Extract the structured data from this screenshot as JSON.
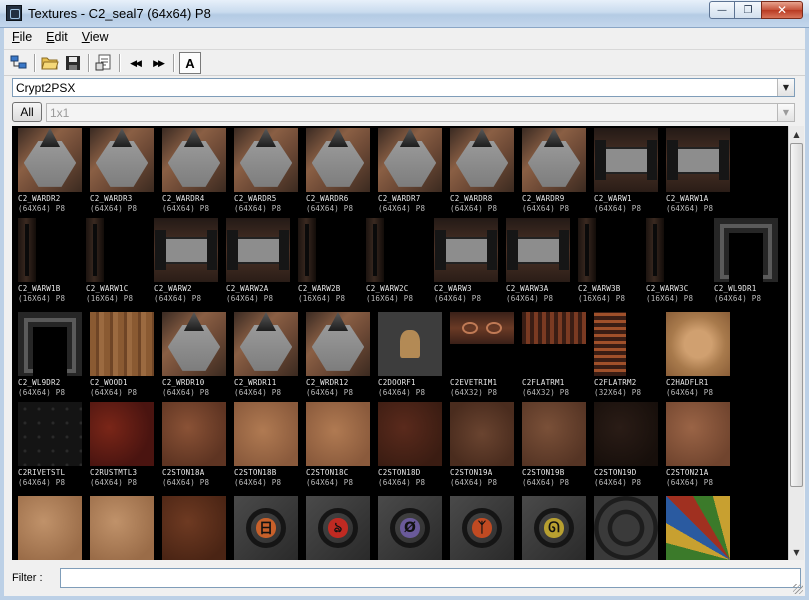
{
  "window": {
    "title": "Textures - C2_seal7 (64x64) P8",
    "min_glyph": "—",
    "max_glyph": "❐",
    "close_glyph": "✕"
  },
  "menu": [
    {
      "label": "File",
      "mnemonic": "F",
      "rest": "ile"
    },
    {
      "label": "Edit",
      "mnemonic": "E",
      "rest": "dit"
    },
    {
      "label": "View",
      "mnemonic": "V",
      "rest": "iew"
    }
  ],
  "toolbar": {
    "icons": [
      "window-tree-icon",
      "open-folder-icon",
      "save-disk-icon",
      "properties-icon",
      "previous-icon",
      "next-icon",
      "font-icon"
    ],
    "prev_glyph": "◀◀",
    "next_glyph": "▶▶",
    "font_label": "A"
  },
  "package_combo": {
    "value": "Crypt2PSX",
    "arrow": "▼"
  },
  "size_filter": {
    "all_label": "All",
    "value": "1x1",
    "arrow": "▼"
  },
  "textures": [
    [
      {
        "name": "C2_WARDR2",
        "size": "(64X64) P8",
        "style": "ward"
      },
      {
        "name": "C2_WARDR3",
        "size": "(64X64) P8",
        "style": "ward"
      },
      {
        "name": "C2_WARDR4",
        "size": "(64X64) P8",
        "style": "ward"
      },
      {
        "name": "C2_WARDR5",
        "size": "(64X64) P8",
        "style": "ward"
      },
      {
        "name": "C2_WARDR6",
        "size": "(64X64) P8",
        "style": "ward"
      },
      {
        "name": "C2_WARDR7",
        "size": "(64X64) P8",
        "style": "ward"
      },
      {
        "name": "C2_WARDR8",
        "size": "(64X64) P8",
        "style": "ward"
      },
      {
        "name": "C2_WARDR9",
        "size": "(64X64) P8",
        "style": "ward"
      },
      {
        "name": "C2_WARW1",
        "size": "(64X64) P8",
        "style": "warw"
      },
      {
        "name": "C2_WARW1A",
        "size": "(64X64) P8",
        "style": "warw"
      }
    ],
    [
      {
        "name": "C2_WARW1B",
        "size": "(16X64) P8",
        "style": "thin"
      },
      {
        "name": "C2_WARW1C",
        "size": "(16X64) P8",
        "style": "thin"
      },
      {
        "name": "C2_WARW2",
        "size": "(64X64) P8",
        "style": "warw"
      },
      {
        "name": "C2_WARW2A",
        "size": "(64X64) P8",
        "style": "warw"
      },
      {
        "name": "C2_WARW2B",
        "size": "(16X64) P8",
        "style": "thin"
      },
      {
        "name": "C2_WARW2C",
        "size": "(16X64) P8",
        "style": "thin"
      },
      {
        "name": "C2_WARW3",
        "size": "(64X64) P8",
        "style": "warw"
      },
      {
        "name": "C2_WARW3A",
        "size": "(64X64) P8",
        "style": "warw"
      },
      {
        "name": "C2_WARW3B",
        "size": "(16X64) P8",
        "style": "thin"
      },
      {
        "name": "C2_WARW3C",
        "size": "(16X64) P8",
        "style": "thin"
      },
      {
        "name": "C2_WL9DR1",
        "size": "(64X64) P8",
        "style": "door"
      }
    ],
    [
      {
        "name": "C2_WL9DR2",
        "size": "(64X64) P8",
        "style": "door"
      },
      {
        "name": "C2_WOOD1",
        "size": "(64X64) P8",
        "style": "wood"
      },
      {
        "name": "C2_WRDR10",
        "size": "(64X64) P8",
        "style": "ward"
      },
      {
        "name": "C2_WRDR11",
        "size": "(64X64) P8",
        "style": "ward"
      },
      {
        "name": "C2_WRDR12",
        "size": "(64X64) P8",
        "style": "ward"
      },
      {
        "name": "C2DOORF1",
        "size": "(64X64) P8",
        "style": "dfig"
      },
      {
        "name": "C2EVETRIM1",
        "size": "(64X32) P8",
        "style": "eye"
      },
      {
        "name": "C2FLATRM1",
        "size": "(64X32) P8",
        "style": "flat"
      },
      {
        "name": "C2FLATRM2",
        "size": "(32X64) P8",
        "style": "flatv"
      },
      {
        "name": "C2HADFLR1",
        "size": "(64X64) P8",
        "style": "had"
      }
    ],
    [
      {
        "name": "C2RIVETSTL",
        "size": "(64X64) P8",
        "style": "rivet"
      },
      {
        "name": "C2RUSTMTL3",
        "size": "(64X64) P8",
        "style": "rust"
      },
      {
        "name": "C2STON18A",
        "size": "(64X64) P8",
        "style": "ston1"
      },
      {
        "name": "C2STON18B",
        "size": "(64X64) P8",
        "style": "ston2"
      },
      {
        "name": "C2STON18C",
        "size": "(64X64) P8",
        "style": "ston2"
      },
      {
        "name": "C2STON18D",
        "size": "(64X64) P8",
        "style": "ston3"
      },
      {
        "name": "C2STON19A",
        "size": "(64X64) P8",
        "style": "ston4"
      },
      {
        "name": "C2STON19B",
        "size": "(64X64) P8",
        "style": "ston5"
      },
      {
        "name": "C2STON19D",
        "size": "(64X64) P8",
        "style": "ston6"
      },
      {
        "name": "C2STON21A",
        "size": "(64X64) P8",
        "style": "ston7"
      }
    ],
    [
      {
        "name": "",
        "size": "",
        "style": "sand"
      },
      {
        "name": "",
        "size": "",
        "style": "sand"
      },
      {
        "name": "",
        "size": "",
        "style": "brown"
      },
      {
        "name": "",
        "size": "",
        "style": "seal",
        "glyph": "日",
        "color": "#c8602a"
      },
      {
        "name": "",
        "size": "",
        "style": "seal",
        "glyph": "ঌ",
        "color": "#c02a22"
      },
      {
        "name": "",
        "size": "",
        "style": "seal",
        "glyph": "Ø",
        "color": "#6a5a9a"
      },
      {
        "name": "",
        "size": "",
        "style": "seal",
        "glyph": "ᛉ",
        "color": "#c04a22"
      },
      {
        "name": "",
        "size": "",
        "style": "seal",
        "glyph": "ᘏ",
        "color": "#b8a030"
      },
      {
        "name": "",
        "size": "",
        "style": "web"
      },
      {
        "name": "",
        "size": "",
        "style": "mosaic"
      }
    ]
  ],
  "scrollbar": {
    "up": "▲",
    "down": "▼"
  },
  "filter": {
    "label": "Filter :",
    "value": ""
  }
}
